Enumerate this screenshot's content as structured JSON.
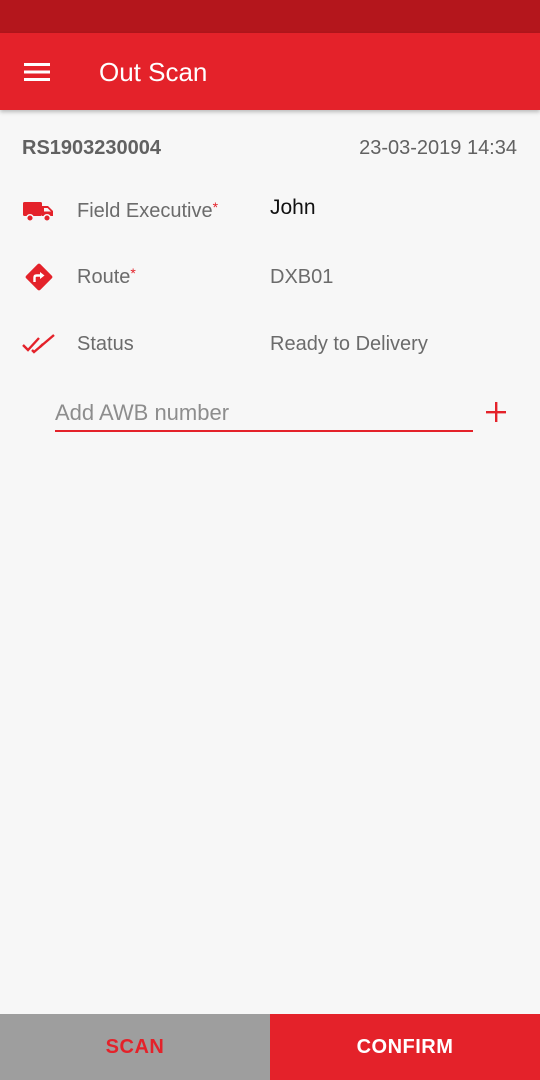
{
  "app_bar": {
    "title": "Out Scan",
    "menu_icon": "hamburger-menu-icon",
    "color": "#e4222a",
    "status_bar_color": "#b4161c"
  },
  "header": {
    "reference": "RS1903230004",
    "datetime": "23-03-2019 14:34"
  },
  "fields": {
    "field_executive": {
      "icon": "truck-icon",
      "label": "Field Executive",
      "required_mark": "*",
      "value": "John"
    },
    "route": {
      "icon": "route-turn-icon",
      "label": "Route",
      "required_mark": "*",
      "value": "DXB01"
    },
    "status": {
      "icon": "double-check-icon",
      "label": "Status",
      "value": "Ready to Delivery"
    }
  },
  "awb": {
    "placeholder": "Add AWB number",
    "value": "",
    "add_icon": "plus-icon"
  },
  "footer": {
    "scan_label": "SCAN",
    "confirm_label": "CONFIRM",
    "scan_bg": "#9e9e9e",
    "confirm_bg": "#e4222a"
  }
}
